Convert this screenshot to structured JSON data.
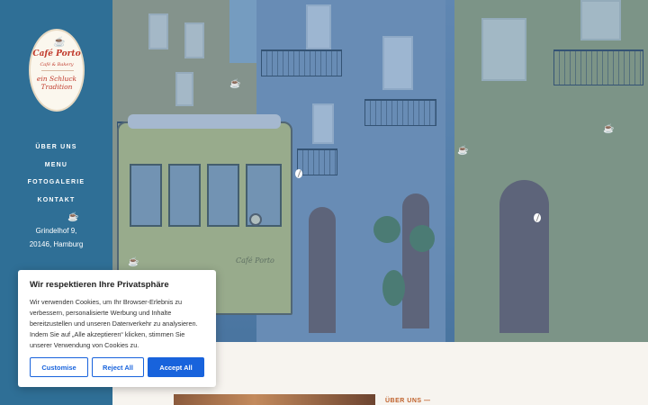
{
  "logo": {
    "title": "Café Porto",
    "subtitle": "Café & Bakery",
    "tagline_line1": "ein Schluck",
    "tagline_line2": "Tradition",
    "cup_icon": "coffee-cup-icon"
  },
  "nav": {
    "items": [
      {
        "label": "ÜBER UNS"
      },
      {
        "label": "MENU"
      },
      {
        "label": "FOTOGALERIE"
      },
      {
        "label": "KONTAKT"
      }
    ]
  },
  "address": {
    "line1": "Grindelhof 9,",
    "line2": "20146, Hamburg"
  },
  "hero": {
    "tram_name": "Café Porto"
  },
  "section": {
    "about_label": "ÜBER UNS —"
  },
  "cookie": {
    "title": "Wir respektieren Ihre Privatsphäre",
    "text": "Wir verwenden Cookies, um Ihr Browser-Erlebnis zu verbessern, personalisierte Werbung und Inhalte bereitzustellen und unseren Datenverkehr zu analysieren. Indem Sie auf „Alle akzeptieren“ klicken, stimmen Sie unserer Verwendung von Cookies zu.",
    "customise_label": "Customise",
    "reject_label": "Reject All",
    "accept_label": "Accept All"
  },
  "colors": {
    "sidebar": "#2f6f96",
    "accent_red": "#c0392b",
    "button_blue": "#1863dc"
  }
}
